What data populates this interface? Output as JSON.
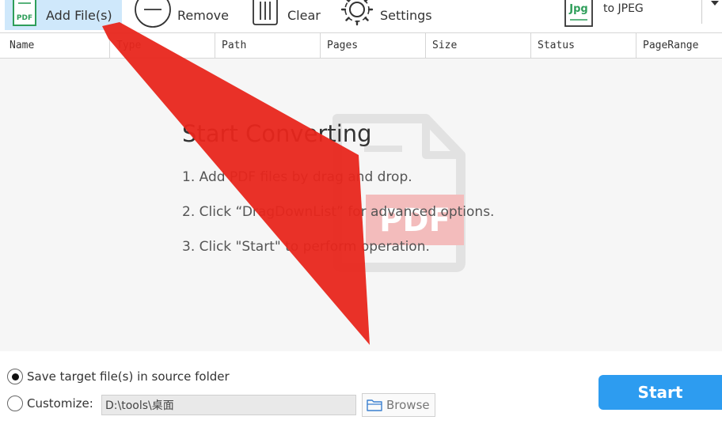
{
  "toolbar": {
    "add_files": "Add File(s)",
    "remove": "Remove",
    "clear": "Clear",
    "settings": "Settings",
    "format_badge": "Jpg",
    "format_target": "to JPEG",
    "add_icon_text": "PDF"
  },
  "table": {
    "columns": [
      "Name",
      "Type",
      "Path",
      "Pages",
      "Size",
      "Status",
      "PageRange"
    ]
  },
  "drop_area": {
    "title": "Start Converting",
    "steps": [
      "1. Add PDF files by drag and drop.",
      "2. Click “DragDownList” for advanced options.",
      "3. Click \"Start\" to perform operation."
    ],
    "watermark_text": "PDF"
  },
  "output": {
    "save_in_source": "Save target file(s) in source folder",
    "customize": "Customize:",
    "path": "D:\\tools\\桌面",
    "browse": "Browse",
    "start": "Start",
    "selected_option": "save_in_source"
  },
  "colors": {
    "accent": "#2d9cf0",
    "add_button_bg": "#cfe8fb",
    "icon_green": "#2e9e5a",
    "annotation_red": "#e8261c"
  }
}
